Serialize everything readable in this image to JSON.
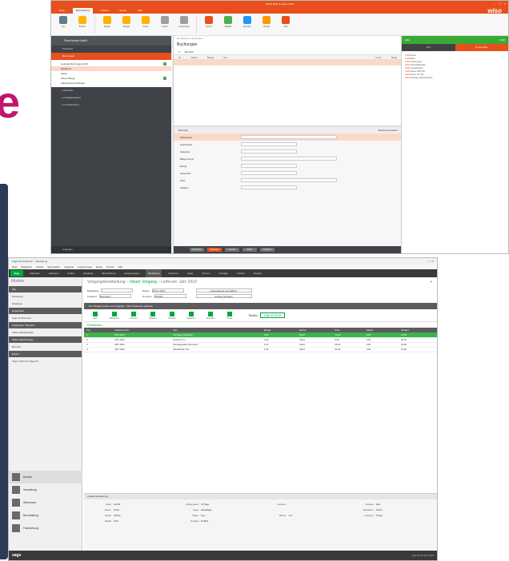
{
  "wiso": {
    "window_title": "WISO EÜR & Kasse 2019",
    "logo": "wiso",
    "ribbon_tabs": [
      "Datei",
      "Buchhaltung",
      "Ansicht",
      "Extras",
      "Hilfe"
    ],
    "ribbon_buttons": [
      {
        "label": "Neu",
        "color": "#607d8b"
      },
      {
        "label": "Buchen",
        "color": "#ffb300"
      },
      {
        "label": "Splitten",
        "color": "#ffb300"
      },
      {
        "label": "Belege",
        "color": "#ffb300"
      },
      {
        "label": "Kasse",
        "color": "#ffb300"
      },
      {
        "label": "Konten",
        "color": "#9e9e9e"
      },
      {
        "label": "Auswertung",
        "color": "#9e9e9e"
      },
      {
        "label": "Export",
        "color": "#e84f1c"
      },
      {
        "label": "Statistik",
        "color": "#4caf50"
      },
      {
        "label": "Berichte",
        "color": "#2196f3"
      },
      {
        "label": "Umsatz",
        "color": "#ff9800"
      },
      {
        "label": "Hilfe",
        "color": "#e84f1c"
      }
    ],
    "nav": {
      "header": "Firma Muster GmbH",
      "items": [
        "Übersicht",
        "Buchungen"
      ],
      "active_item": "Buchungen",
      "tree": [
        {
          "label": "Laufende Buchungen 2019",
          "selected": false,
          "dot": true
        },
        {
          "label": "Bankkonto",
          "selected": true,
          "dot": false
        },
        {
          "label": "Kasse",
          "selected": false,
          "dot": false
        },
        {
          "label": "Offene Belege",
          "selected": false,
          "dot": true
        },
        {
          "label": "Abgeschlossene Belege",
          "selected": false,
          "dot": false
        }
      ],
      "groups": [
        "Berichte",
        "Anlagenspiegel",
        "Umsatzsteuer"
      ],
      "footer": "Aufgaben"
    },
    "main": {
      "breadcrumb": "Buchhaltung › Buchungen",
      "title": "Buchungen",
      "filter_label": "Alle Filter",
      "columns": [
        "Nr.",
        "Datum",
        "Betrag",
        "Text",
        "Konto",
        "Beleg"
      ],
      "buchung_title": "Buchung",
      "buchung_link": "Buchung erfassen",
      "fields": [
        {
          "label": "Zahlungsart",
          "highlight": true
        },
        {
          "label": "Gegenkonto",
          "highlight": false
        },
        {
          "label": "Kategorie",
          "highlight": false
        },
        {
          "label": "Belegnummer",
          "highlight": false
        },
        {
          "label": "Betrag",
          "highlight": false
        },
        {
          "label": "Steuersatz",
          "highlight": false
        },
        {
          "label": "Notiz",
          "highlight": false
        },
        {
          "label": "Anlagen",
          "highlight": false
        }
      ],
      "bottom_buttons": [
        "Abbrechen",
        "Speichern",
        "Löschen",
        "Weiter",
        "Schließen"
      ]
    },
    "right": {
      "title": "Hilfe",
      "badge": "EÜR",
      "tabs": [
        "Info",
        "Kontenplan"
      ],
      "active_tab": "Kontenplan",
      "lines": [
        {
          "code": "1000",
          "text": "Kasse"
        },
        {
          "code": "1200",
          "text": "Bank"
        },
        {
          "code": "1400",
          "text": "Forderungen"
        },
        {
          "code": "1600",
          "text": "Verbindlichkeiten"
        },
        {
          "code": "4000",
          "text": "Umsatzerlöse"
        },
        {
          "code": "4400",
          "text": "Erlöse 19% USt"
        },
        {
          "code": "4300",
          "text": "Erlöse 7% USt"
        },
        {
          "code": "6300",
          "text": "Sonstige Aufwendungen"
        }
      ]
    }
  },
  "sage": {
    "window_title": "Sage 50 Handwerk — Bestellung",
    "menu": [
      "Datei",
      "Bearbeiten",
      "Ansicht",
      "Stammdaten",
      "Vorgänge",
      "Auswertungen",
      "Extras",
      "Fenster",
      "Hilfe"
    ],
    "nav_logo": "Sage",
    "nav_items": [
      "Startseite",
      "Adressen",
      "Artikel",
      "Vorgänge",
      "Buchhaltung",
      "Auswertungen",
      "Bestellung",
      "Finanzen",
      "Lager",
      "Service",
      "Aufträge",
      "Verkauf",
      "Einkauf"
    ],
    "nav_active": "Bestellung",
    "left": {
      "title": "Module",
      "items": [
        {
          "label": "Alle",
          "style": "dark"
        },
        {
          "label": "Bestellung",
          "style": "light"
        },
        {
          "label": "Eingänge",
          "style": "light"
        },
        {
          "label": "Lieferanten",
          "style": "dark"
        },
        {
          "label": "Sage 50 Business",
          "style": "light"
        },
        {
          "label": "Lieferanten Übersicht",
          "style": "dark"
        },
        {
          "label": "Offene Bestellungen",
          "style": "light"
        },
        {
          "label": "Offene Rechnungen",
          "style": "dark"
        },
        {
          "label": "Berichte",
          "style": "light"
        },
        {
          "label": "Extras",
          "style": "dark"
        },
        {
          "label": "Sage Online für Sage 50",
          "style": "light"
        }
      ],
      "big_items": [
        {
          "label": "Module",
          "active": true
        },
        {
          "label": "Verwaltung",
          "active": false
        },
        {
          "label": "Warenwelt",
          "active": false
        },
        {
          "label": "Buchhaltung",
          "active": false
        },
        {
          "label": "Fakturierung",
          "active": false
        }
      ]
    },
    "main": {
      "title": "Vorgangsbearbeitung –",
      "title_highlight": "Neuer Vorgang",
      "title_rest": "– Lieferant: Jahr 2019",
      "fields_left": [
        {
          "label": "Bestellung",
          "value": ""
        },
        {
          "label": "Lieferant",
          "value": "Kaufmann"
        }
      ],
      "fields_right": [
        {
          "label": "Datum",
          "value": "09.07.2019"
        },
        {
          "label": "Nummer",
          "value": "B-0002"
        }
      ],
      "action_buttons": [
        "Lieferadresse auswählen",
        "Auftrag anzeigen"
      ],
      "infobar": "Der Vorgang wurde neu angelegt – bitte Positionen erfassen",
      "toolbar": [
        "Neu",
        "Bearbeiten",
        "Löschen",
        "Kopieren",
        "Drucken",
        "Speichern",
        "Stückliste",
        "Preise"
      ],
      "brutto_label": "Brutto",
      "brutto_value": "138,42 EUR",
      "positions_title": "Positionen",
      "columns": [
        "Pos.",
        "Artikelnummer",
        "Text",
        "Menge",
        "Einheit",
        "Preis",
        "Rabatt",
        "Gesamt"
      ],
      "rows": [
        [
          "1",
          "ART-1001",
          "Schraube Edelstahl",
          "2,00",
          "Stück",
          "12,00",
          "0,00",
          "24,00",
          "sel"
        ],
        [
          "2",
          "ART-1002",
          "Dübel 8 mm",
          "3,00",
          "Stück",
          "8,50",
          "0,00",
          "25,50",
          ""
        ],
        [
          "3",
          "ART-1003",
          "Montageplatte Aluminium",
          "1,00",
          "Stück",
          "45,00",
          "0,00",
          "45,00",
          ""
        ],
        [
          "4",
          "ART-1004",
          "Kabelbinder Set",
          "1,00",
          "Stück",
          "21,82",
          "0,00",
          "21,82",
          ""
        ]
      ],
      "footer_title": "Zusammenfassung",
      "footer": [
        [
          "Netto",
          "116,32"
        ],
        [
          "Zahlungsziel",
          "14 Tage"
        ],
        [
          "Lieferant",
          ""
        ],
        [
          "Versand",
          "DHL"
        ],
        [
          "Steuer",
          "22,10"
        ],
        [
          "Lager",
          "Hauptlager"
        ],
        [
          "",
          ""
        ],
        [
          "Bearbeiter",
          "Admin"
        ],
        [
          "Brutto",
          "138,42"
        ],
        [
          "Status",
          "Neu"
        ],
        [
          "Skonto",
          "2 %"
        ],
        [
          "Lieferzeit",
          "5 Tage"
        ],
        [
          "Rabatt",
          "0,00"
        ],
        [
          "Vorgang",
          "B-0002"
        ],
        [
          "",
          ""
        ],
        [
          "",
          ""
        ]
      ]
    },
    "status_logo": "sage",
    "status_right": "Sage 50 Handwerk 2019"
  },
  "decor": {
    "brand_letter": "e"
  }
}
